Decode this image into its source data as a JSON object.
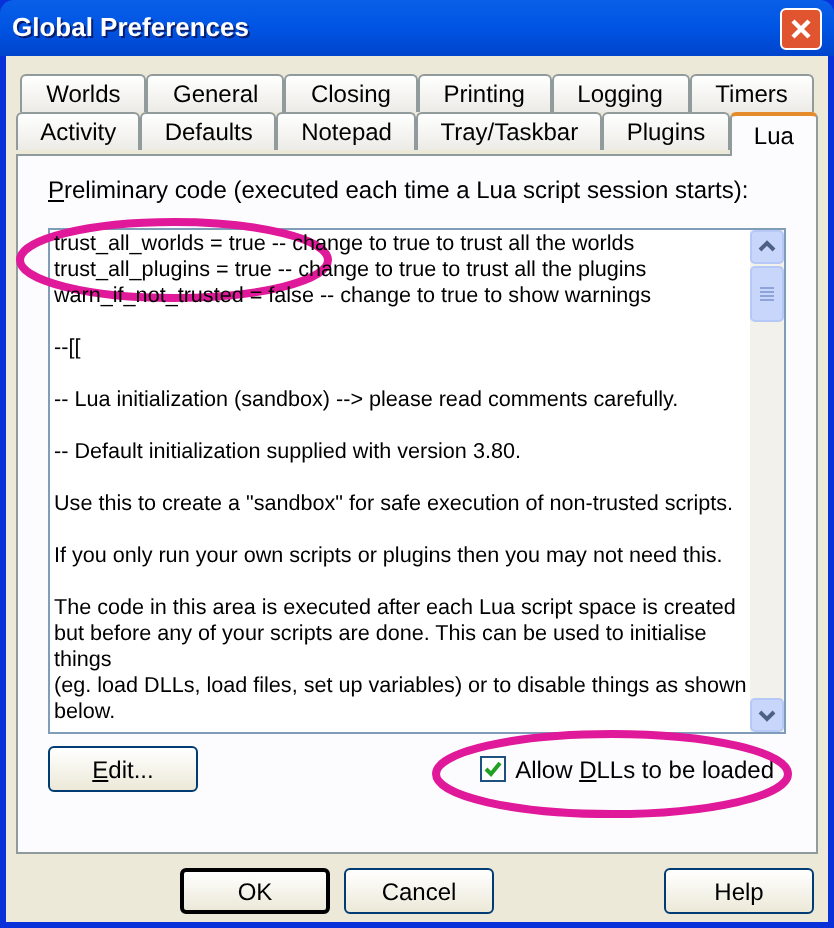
{
  "window": {
    "title": "Global Preferences"
  },
  "tabs": [
    [
      {
        "label": "Worlds",
        "selected": false
      },
      {
        "label": "General",
        "selected": false
      },
      {
        "label": "Closing",
        "selected": false
      },
      {
        "label": "Printing",
        "selected": false
      },
      {
        "label": "Logging",
        "selected": false
      },
      {
        "label": "Timers",
        "selected": false
      }
    ],
    [
      {
        "label": "Activity",
        "selected": false
      },
      {
        "label": "Defaults",
        "selected": false
      },
      {
        "label": "Notepad",
        "selected": false
      },
      {
        "label": "Tray/Taskbar",
        "selected": false
      },
      {
        "label": "Plugins",
        "selected": false
      },
      {
        "label": "Lua",
        "selected": true
      }
    ]
  ],
  "code_label": {
    "mnemonic": "P",
    "after": "reliminary code (executed each time a Lua script session starts):"
  },
  "code_paragraphs": [
    [
      "trust_all_worlds = true -- change to true to trust all the worlds",
      "trust_all_plugins = true -- change to true to trust all the plugins",
      "warn_if_not_trusted = false -- change to true to show warnings"
    ],
    [
      "--[["
    ],
    [
      "-- Lua initialization (sandbox) --> please read comments carefully."
    ],
    [
      "-- Default initialization supplied with version 3.80."
    ],
    [
      "Use this to create a \"sandbox\" for safe execution of non-trusted scripts."
    ],
    [
      "If you only run your own scripts or plugins then you may not need this."
    ],
    [
      "The code in this area is executed after each Lua script space is created",
      "but before any of your scripts are done. This can be used to initialise",
      "things",
      "(eg. load DLLs, load files, set up variables) or to disable things as shown",
      "below."
    ]
  ],
  "edit_button": {
    "mnemonic": "E",
    "after": "dit..."
  },
  "allow_dlls": {
    "before": "Allow ",
    "mnemonic": "D",
    "after": "LLs to be loaded",
    "checked": true
  },
  "buttons": [
    {
      "label": "OK",
      "default": true
    },
    {
      "label": "Cancel",
      "default": false
    },
    {
      "label": "Help",
      "default": false
    }
  ]
}
